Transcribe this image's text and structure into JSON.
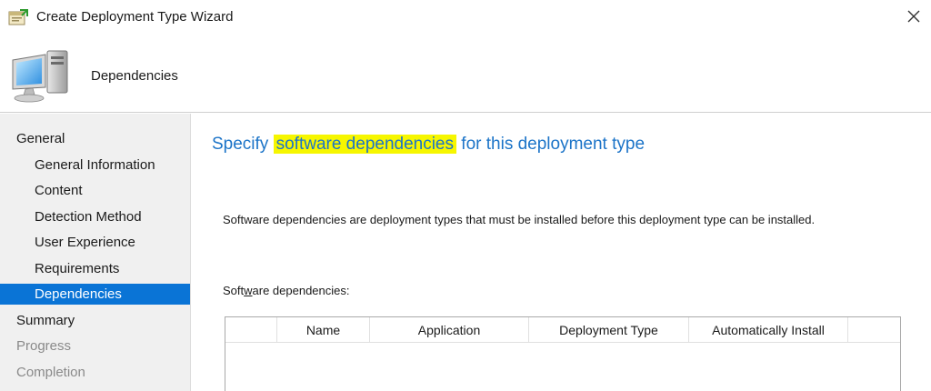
{
  "window": {
    "title": "Create Deployment Type Wizard",
    "close_icon": "close-icon"
  },
  "header": {
    "title": "Dependencies",
    "icon": "computer-icon"
  },
  "nav": {
    "items": [
      {
        "label": "General",
        "level": 0,
        "state": "normal"
      },
      {
        "label": "General Information",
        "level": 1,
        "state": "normal"
      },
      {
        "label": "Content",
        "level": 1,
        "state": "normal"
      },
      {
        "label": "Detection Method",
        "level": 1,
        "state": "normal"
      },
      {
        "label": "User Experience",
        "level": 1,
        "state": "normal"
      },
      {
        "label": "Requirements",
        "level": 1,
        "state": "normal"
      },
      {
        "label": "Dependencies",
        "level": 1,
        "state": "selected"
      },
      {
        "label": "Summary",
        "level": 0,
        "state": "normal"
      },
      {
        "label": "Progress",
        "level": 0,
        "state": "disabled"
      },
      {
        "label": "Completion",
        "level": 0,
        "state": "disabled"
      }
    ]
  },
  "content": {
    "heading_before": "Specify ",
    "heading_highlight": "software dependencies",
    "heading_after": " for this deployment type",
    "description": "Software dependencies are deployment types that must be installed before this deployment type can be installed.",
    "list_label_pre": "Soft",
    "list_label_accel": "w",
    "list_label_post": "are dependencies:",
    "columns": [
      "",
      "Name",
      "Application",
      "Deployment Type",
      "Automatically Install"
    ]
  },
  "colors": {
    "accent": "#1c74c8",
    "selected": "#0a74d6",
    "highlight": "#f6f600"
  }
}
